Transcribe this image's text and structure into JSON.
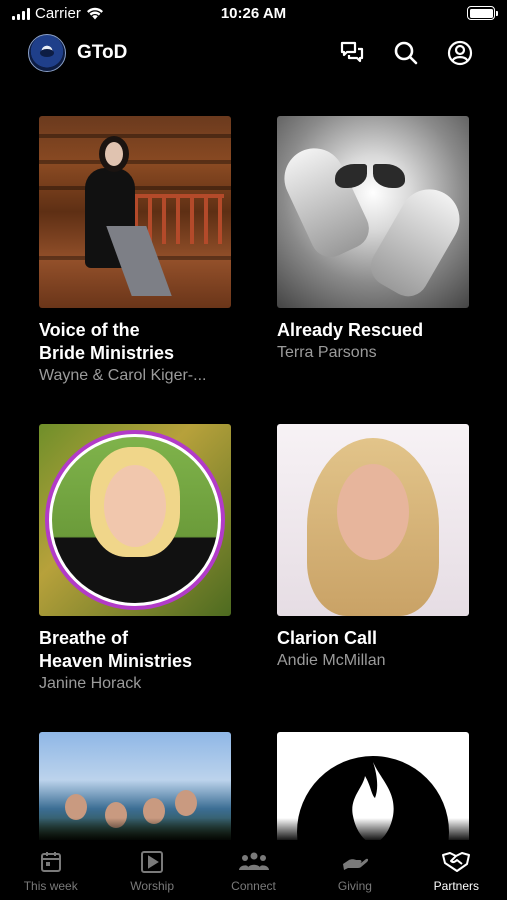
{
  "status_bar": {
    "carrier": "Carrier",
    "time": "10:26 AM"
  },
  "header": {
    "title": "GToD",
    "icons": [
      "chat-icon",
      "search-icon",
      "account-icon"
    ]
  },
  "cards": [
    {
      "title": "Voice of the\nBride Ministries",
      "subtitle": "Wayne & Carol Kiger-..."
    },
    {
      "title": "Already Rescued",
      "subtitle": "Terra Parsons"
    },
    {
      "title": "Breathe of\nHeaven Ministries",
      "subtitle": "Janine Horack"
    },
    {
      "title": "Clarion Call",
      "subtitle": "Andie McMillan"
    },
    {
      "title": "",
      "subtitle": ""
    },
    {
      "title": "",
      "subtitle": ""
    }
  ],
  "tabs": [
    {
      "label": "This week",
      "icon": "calendar-icon",
      "active": false
    },
    {
      "label": "Worship",
      "icon": "play-icon",
      "active": false
    },
    {
      "label": "Connect",
      "icon": "people-icon",
      "active": false
    },
    {
      "label": "Giving",
      "icon": "hand-icon",
      "active": false
    },
    {
      "label": "Partners",
      "icon": "handshake-icon",
      "active": true
    }
  ],
  "colors": {
    "background": "#000000",
    "muted_text": "#9b9b9b",
    "inactive_tab": "#7a7a7a"
  }
}
